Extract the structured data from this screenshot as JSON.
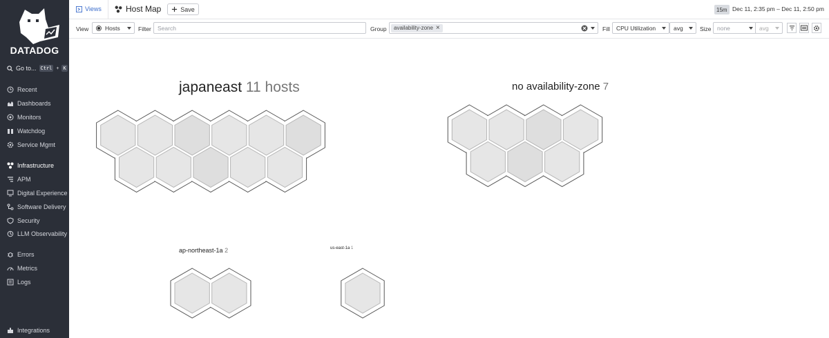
{
  "sidebar": {
    "brand": "DATADOG",
    "goto_label": "Go to...",
    "goto_keys": [
      "Ctrl",
      "+",
      "K"
    ],
    "items": [
      {
        "label": "Recent",
        "icon": "clock-icon"
      },
      {
        "label": "Dashboards",
        "icon": "chart-icon"
      },
      {
        "label": "Monitors",
        "icon": "monitor-icon"
      },
      {
        "label": "Watchdog",
        "icon": "binoculars-icon"
      },
      {
        "label": "Service Mgmt",
        "icon": "gear-icon"
      },
      {
        "label": "Infrastructure",
        "icon": "nodes-icon"
      },
      {
        "label": "APM",
        "icon": "list-icon"
      },
      {
        "label": "Digital Experience",
        "icon": "screen-icon"
      },
      {
        "label": "Software Delivery",
        "icon": "delivery-icon"
      },
      {
        "label": "Security",
        "icon": "shield-icon"
      },
      {
        "label": "LLM Observability",
        "icon": "loop-icon"
      },
      {
        "label": "Errors",
        "icon": "bug-icon"
      },
      {
        "label": "Metrics",
        "icon": "gauge-icon"
      },
      {
        "label": "Logs",
        "icon": "logs-icon"
      },
      {
        "label": "Integrations",
        "icon": "puzzle-icon"
      }
    ]
  },
  "topbar": {
    "views_label": "Views",
    "title": "Host Map",
    "save_label": "Save",
    "time_badge": "15m",
    "time_range": "Dec 11, 2:35 pm – Dec 11, 2:50 pm"
  },
  "controls": {
    "view_label": "View",
    "view_value": "Hosts",
    "filter_label": "Filter",
    "filter_placeholder": "Search",
    "group_label": "Group",
    "group_chip": "availability-zone",
    "fill_label": "Fill",
    "fill_metric": "CPU Utilization",
    "fill_agg": "avg",
    "size_label": "Size",
    "size_metric": "none",
    "size_agg": "avg"
  },
  "groups": [
    {
      "name": "japaneast",
      "count": "11 hosts",
      "hosts": 11
    },
    {
      "name": "no availability-zone",
      "count": "7",
      "hosts": 7
    },
    {
      "name": "ap-northeast-1a",
      "count": "2",
      "hosts": 2
    },
    {
      "name": "us-east-1a",
      "count": "1",
      "hosts": 1
    }
  ],
  "colors": {
    "sidebar_bg": "#2b2f38",
    "accent": "#3d6ecc",
    "hex_fill": "#e6e6e6",
    "hex_fill_dark": "#dedede",
    "hex_stroke": "#b5b5b5"
  }
}
